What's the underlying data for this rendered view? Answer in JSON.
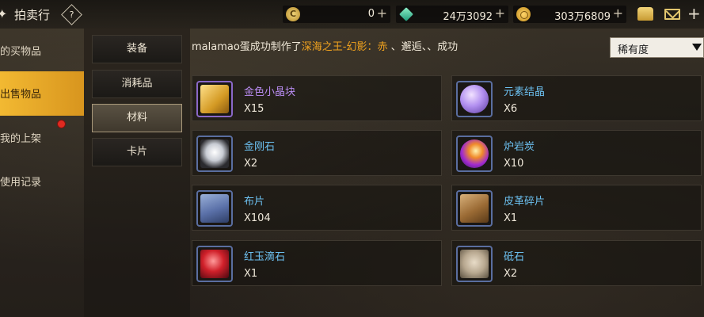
{
  "header": {
    "title": "拍卖行",
    "help_label": "?"
  },
  "currencies": [
    {
      "icon": "c-coin-icon",
      "value": "0"
    },
    {
      "icon": "green-gem-icon",
      "value": "24万3092"
    },
    {
      "icon": "gold-coin-icon",
      "value": "303万6809"
    }
  ],
  "leftnav": {
    "items": [
      {
        "label": "的买物品",
        "active": false
      },
      {
        "label": "出售物品",
        "active": true
      },
      {
        "label": "我的上架",
        "active": false
      },
      {
        "label": "使用记录",
        "active": false
      }
    ]
  },
  "categories": [
    {
      "label": "装备",
      "active": false
    },
    {
      "label": "消耗品",
      "active": false
    },
    {
      "label": "材料",
      "active": true
    },
    {
      "label": "卡片",
      "active": false
    }
  ],
  "ticker": {
    "prefix": "malamao蛋成功制作了",
    "highlight": "深海之王-幻影：赤",
    "suffix": "      、邂逅、、成功"
  },
  "sort": {
    "label": "稀有度"
  },
  "items": [
    {
      "name": "金色小晶块",
      "qty": "X15",
      "color": "purple",
      "icon": "gold-crystal-icon"
    },
    {
      "name": "元素结晶",
      "qty": "X6",
      "color": "blue",
      "icon": "element-crystal-icon"
    },
    {
      "name": "金刚石",
      "qty": "X2",
      "color": "blue",
      "icon": "diamond-icon"
    },
    {
      "name": "炉岩炭",
      "qty": "X10",
      "color": "blue",
      "icon": "furnace-coal-icon"
    },
    {
      "name": "布片",
      "qty": "X104",
      "color": "blue",
      "icon": "cloth-icon"
    },
    {
      "name": "皮革碎片",
      "qty": "X1",
      "color": "blue",
      "icon": "leather-icon"
    },
    {
      "name": "红玉滴石",
      "qty": "X1",
      "color": "blue",
      "icon": "ruby-icon"
    },
    {
      "name": "砥石",
      "qty": "X2",
      "color": "blue",
      "icon": "whetstone-icon"
    }
  ]
}
